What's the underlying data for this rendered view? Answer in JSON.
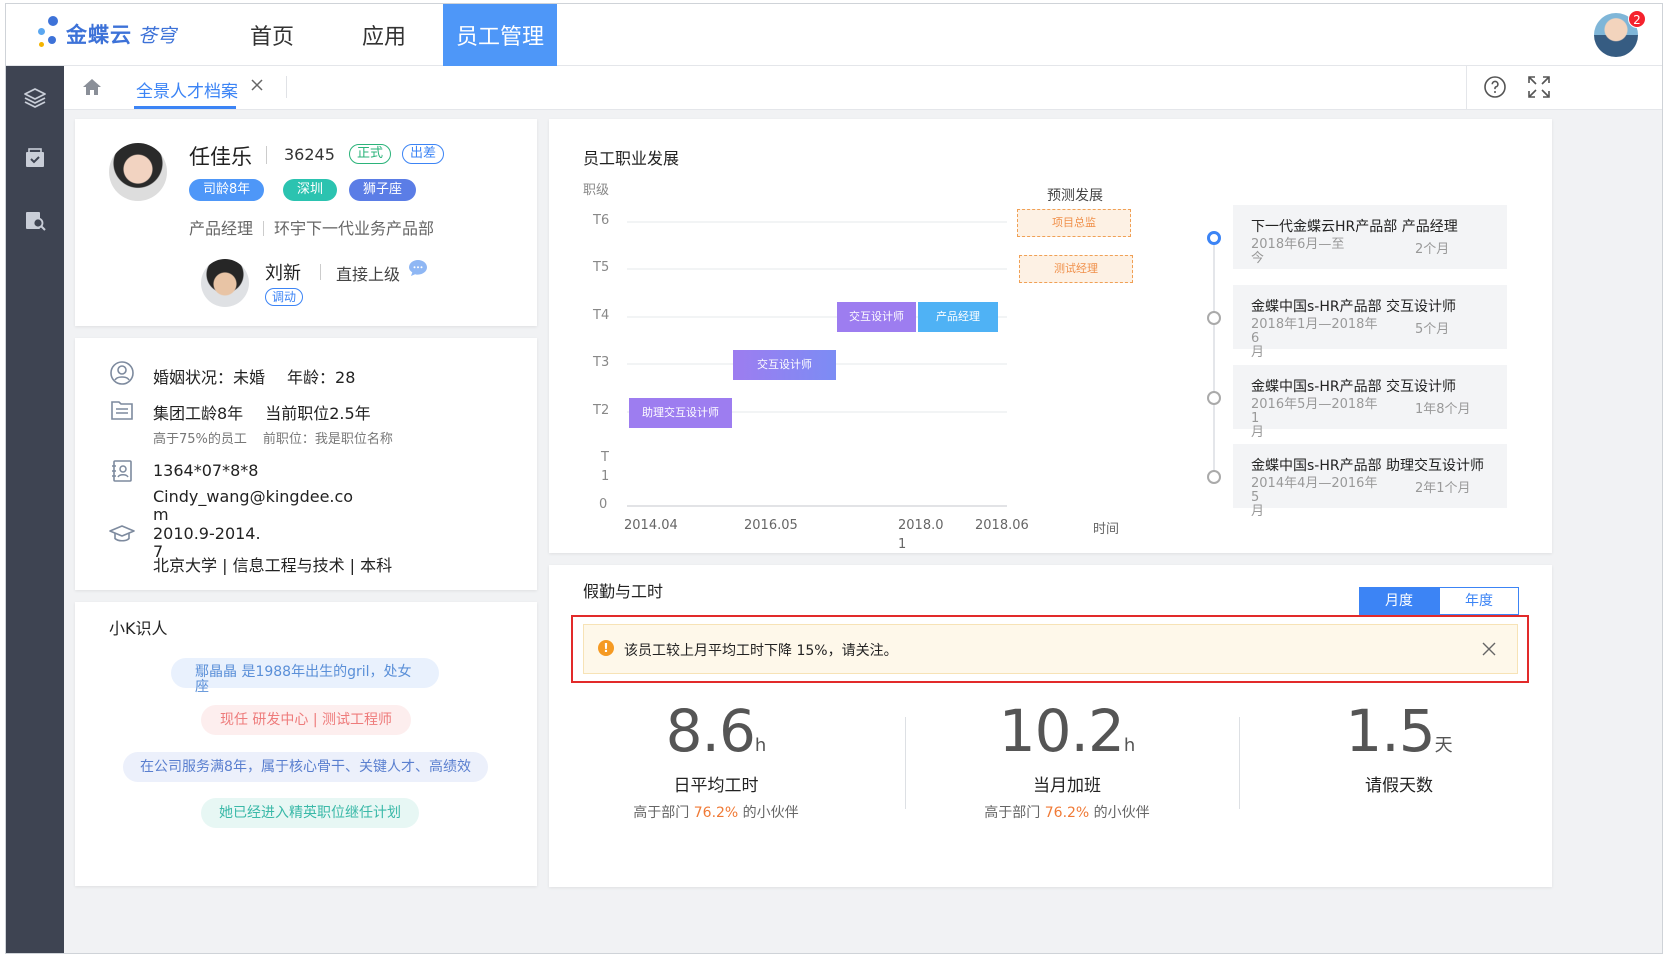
{
  "header": {
    "logo_text": "金蝶云",
    "logo_sub": "苍穹",
    "nav": [
      {
        "label": "首页"
      },
      {
        "label": "应用"
      },
      {
        "label": "员工管理"
      }
    ],
    "notification_count": "2"
  },
  "tabbar": {
    "tab_label": "全景人才档案"
  },
  "profile": {
    "name": "任佳乐",
    "id": "36245",
    "status_tags": [
      "正式",
      "出差"
    ],
    "tags": [
      "司龄8年",
      "深圳",
      "狮子座"
    ],
    "position": "产品经理",
    "department": "环宇下一代业务产品部",
    "manager": {
      "name": "刘新",
      "relation": "直接上级",
      "tag": "调动"
    }
  },
  "info": {
    "marital": "婚姻状况：未婚",
    "age": "年龄：28",
    "group_years": "集团工龄8年",
    "current_position_years": "当前职位2.5年",
    "higher_than": "高于75%的员工",
    "previous_position": "前职位：我是职位名称",
    "phone": "1364*07*8*8",
    "email_line1": "Cindy_wang@kingdee.co",
    "email_line2": "m",
    "edu_period_line1": "2010.9-2014.",
    "edu_period_line2": "7",
    "edu_detail": "北京大学 | 信息工程与技术 | 本科"
  },
  "k_card": {
    "title": "小K识人",
    "bubbles": [
      {
        "text": "鄢晶晶 是1988年出生的gril，处女座",
        "line1": "鄢晶晶 是1988年出生的gril，处女",
        "line2": "座",
        "color": "#5a8fd8",
        "bg": "#e9f1fd"
      },
      {
        "text": "现任  研发中心 | 测试工程师",
        "color": "#ee7b7b",
        "bg": "#fdeeee"
      },
      {
        "text": "在公司服务满8年，属于核心骨干、关键人才、高绩效",
        "color": "#5a7fcf",
        "bg": "#ecf0fb"
      },
      {
        "text": "她已经进入精英职位继任计划",
        "color": "#3ab9a8",
        "bg": "#e7f7f4"
      }
    ]
  },
  "career": {
    "title": "员工职业发展",
    "y_axis_label": "职级",
    "x_axis_label": "时间",
    "prediction_label": "预测发展",
    "y_ticks": [
      "T6",
      "T5",
      "T4",
      "T3",
      "T2",
      "T",
      "1",
      "0"
    ],
    "x_ticks": [
      "2014.04",
      "2016.05",
      "2018.0",
      "1",
      "2018.06"
    ],
    "bars": [
      {
        "label": "助理交互设计师",
        "level": "T2",
        "start": "2014.04",
        "end": "2016.05"
      },
      {
        "label": "交互设计师",
        "level": "T3",
        "start": "2016.05",
        "end": "2018.01"
      },
      {
        "label": "交互设计师",
        "level": "T4",
        "start": "2018.01",
        "end": "2018.06"
      },
      {
        "label": "产品经理",
        "level": "T4",
        "start": "2018.06",
        "end": ""
      }
    ],
    "predicted": [
      {
        "label": "项目总监",
        "level": "T6"
      },
      {
        "label": "测试经理",
        "level": "T5"
      }
    ],
    "timeline": [
      {
        "org_role": "下一代金蝶云HR产品部  产品经理",
        "period_line1": "2018年6月—至",
        "period_line2": "今",
        "duration": "2个月"
      },
      {
        "org_role": "金蝶中国s-HR产品部   交互设计师",
        "period_line1": "2018年1月—2018年6",
        "period_line2": "月",
        "duration": "5个月"
      },
      {
        "org_role": "金蝶中国s-HR产品部   交互设计师",
        "period_line1": "2016年5月—2018年1",
        "period_line2": "月",
        "duration": "1年8个月"
      },
      {
        "org_role": "金蝶中国s-HR产品部   助理交互设计师",
        "period_line1": "2014年4月—2016年5",
        "period_line2": "月",
        "duration": "2年1个月"
      }
    ]
  },
  "attendance": {
    "title": "假勤与工时",
    "toggle": [
      "月度",
      "年度"
    ],
    "alert": "该员工较上月平均工时下降 15%，请关注。",
    "stats": [
      {
        "value": "8.6",
        "unit": "h",
        "label": "日平均工时",
        "sub_pre": "高于部门 ",
        "sub_hl": "76.2%",
        "sub_post": " 的小伙伴"
      },
      {
        "value": "10.2",
        "unit": "h",
        "label": "当月加班",
        "sub_pre": "高于部门 ",
        "sub_hl": "76.2%",
        "sub_post": " 的小伙伴"
      },
      {
        "value": "1.5",
        "unit": "天",
        "label": "请假天数"
      }
    ]
  },
  "colors": {
    "accent": "#3c84f5",
    "nav_active": "#4e97f8",
    "sidebar": "#3e4452",
    "alert_border": "#e22a2a"
  }
}
